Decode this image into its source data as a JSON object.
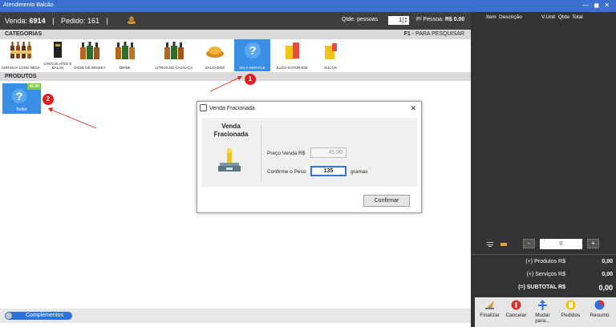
{
  "window": {
    "title": "Atendimento Balcão",
    "controls": "— ◼ ✕"
  },
  "infobar": {
    "venda_label": "Venda:",
    "venda_number": "6914",
    "pedido_label": "Pedido:",
    "pedido_number": "161",
    "qtde_label": "Qtde. pessoas",
    "qtde_value": "1",
    "por_pessoa_label": "P/ Pessoa:",
    "por_pessoa_value": "R$ 0.00"
  },
  "categories_header": {
    "label": "CATEGORIAS",
    "hint_key": "F1",
    "hint_text": "- PARA PESQUISAR"
  },
  "categories": [
    {
      "label": "CERVEJA LONG NECK",
      "icon": "beer-bottles-icon"
    },
    {
      "label": "CHOCOLATES E BALAS",
      "icon": "chocolate-icon"
    },
    {
      "label": "DOSE DE WHISKY",
      "icon": "whisky-bottles-icon"
    },
    {
      "label": "DRINK",
      "icon": "drink-bottles-icon"
    },
    {
      "label": "LITROS DE CACHAÇA",
      "icon": "cachaca-bottles-icon"
    },
    {
      "label": "SALGADOS",
      "icon": "snack-icon"
    },
    {
      "label": "SELF-SERVICE",
      "icon": "question-icon",
      "selected": true
    },
    {
      "label": "SUCO GATORADE",
      "icon": "gatorade-icon"
    },
    {
      "label": "SUCOS",
      "icon": "juice-icon"
    }
  ],
  "products_header": {
    "label": "PRODUTOS"
  },
  "products": [
    {
      "label": "Buffet",
      "price": "45.00",
      "icon": "question-icon"
    }
  ],
  "annotations": [
    "1",
    "2",
    "3"
  ],
  "dialog": {
    "title": "Venda Fracionada",
    "close": "✕",
    "heading_line1": "Venda",
    "heading_line2": "Fracionada",
    "preco_label": "Preço Venda R$",
    "preco_value": "45,00",
    "peso_label": "Confirme o Peso",
    "peso_value": "135",
    "peso_unit": "gramas",
    "confirm_label": "Confirmar"
  },
  "complementos": {
    "label": "Complementos"
  },
  "order_panel": {
    "columns": [
      "Item",
      "Descrição",
      "V.Unit",
      "Qtde",
      "Total"
    ],
    "counter_value": "0",
    "minus_label": "-",
    "plus_label": "+",
    "produtos_label": "(+) Produtos R$",
    "produtos_value": "0,00",
    "servicos_label": "(+) Serviços R$",
    "servicos_value": "0,00",
    "subtotal_label": "(=) SUBTOTAL R$",
    "subtotal_value": "0,00"
  },
  "actions": [
    {
      "label": "Finalizar",
      "icon": "checkout-icon"
    },
    {
      "label": "Cancelar",
      "icon": "cancel-icon"
    },
    {
      "label": "Mudar para...",
      "icon": "move-icon"
    },
    {
      "label": "Pedidos",
      "icon": "orders-icon"
    },
    {
      "label": "Resumo",
      "icon": "summary-icon"
    }
  ],
  "colors": {
    "accent": "#3a8ee6",
    "titlebar": "#3d6fd0",
    "annotation": "#e02020",
    "price_badge": "#7ac943"
  }
}
